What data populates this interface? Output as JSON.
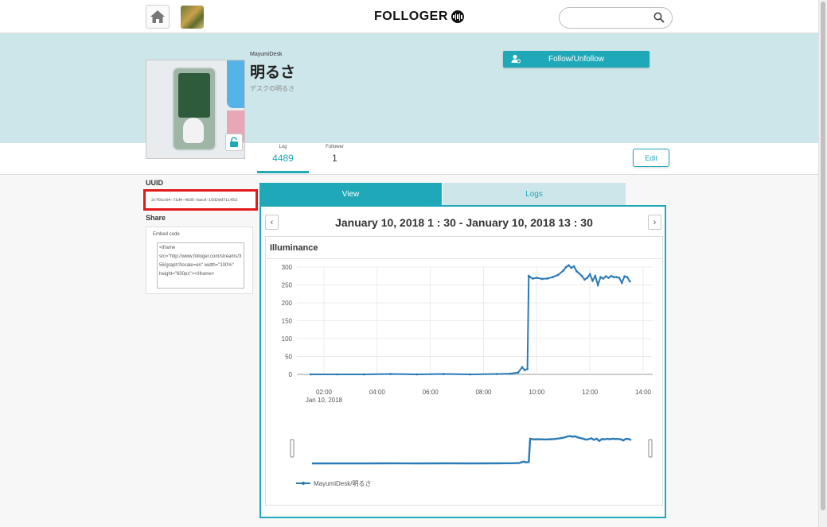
{
  "header": {
    "logo_text": "FOLLOGER",
    "search": {
      "value": "",
      "placeholder": ""
    }
  },
  "profile": {
    "owner": "MayumiDesk",
    "title": "明るさ",
    "description": "デスクの明るさ",
    "follow_label": "Follow/Unfollow",
    "edit_label": "Edit",
    "stats": {
      "log_label": "Log",
      "log_value": "4489",
      "follower_label": "Follower",
      "follower_value": "1"
    }
  },
  "sidebar": {
    "uuid_label": "UUID",
    "uuid_value": "2cf01c84-71d4-4835-bacd-15d29d711453",
    "share_label": "Share",
    "embed_label": "Embed code",
    "embed_code": "<iframe src=\"http://www.folloger.com/streams/356/graph?locale=en\" width=\"100%\" height=\"600px\"></iframe>"
  },
  "tabs": {
    "view_label": "View",
    "logs_label": "Logs"
  },
  "date_range": "January 10, 2018 1 : 30 - January 10, 2018 13 : 30",
  "colors": {
    "accent": "#1fa8b8",
    "banner": "#cde6ea",
    "series": "#2a7ab8",
    "highlight": "#e31a1a"
  },
  "chart_data": {
    "type": "line",
    "title": "Illuminance",
    "xlabel": "",
    "ylabel": "",
    "x_ticks": [
      "02:00",
      "04:00",
      "06:00",
      "08:00",
      "10:00",
      "12:00",
      "14:00"
    ],
    "x_sublabel": "Jan 10, 2018",
    "y_ticks": [
      0,
      50,
      100,
      150,
      200,
      250,
      300
    ],
    "xlim": [
      1.5,
      14.0
    ],
    "ylim": [
      0,
      300
    ],
    "grid": true,
    "legend": "bottom-left",
    "series": [
      {
        "name": "MayumiDesk/明るさ",
        "x": [
          1.5,
          2.5,
          3.5,
          4.5,
          5.5,
          6.5,
          7.5,
          8.5,
          9.0,
          9.3,
          9.45,
          9.55,
          9.65,
          9.7,
          9.75,
          9.85,
          10.0,
          10.2,
          10.4,
          10.6,
          10.8,
          11.0,
          11.1,
          11.2,
          11.3,
          11.4,
          11.5,
          11.6,
          11.7,
          11.8,
          11.9,
          12.0,
          12.1,
          12.2,
          12.3,
          12.4,
          12.5,
          12.6,
          12.7,
          12.8,
          12.9,
          13.0,
          13.1,
          13.2,
          13.3,
          13.4,
          13.5
        ],
        "y": [
          0,
          0,
          0,
          1,
          0,
          1,
          0,
          1,
          2,
          5,
          20,
          12,
          15,
          275,
          272,
          268,
          270,
          267,
          268,
          272,
          278,
          290,
          300,
          305,
          298,
          302,
          288,
          282,
          275,
          265,
          270,
          280,
          262,
          275,
          250,
          272,
          268,
          274,
          270,
          275,
          272,
          272,
          270,
          256,
          274,
          272,
          260
        ]
      }
    ]
  }
}
